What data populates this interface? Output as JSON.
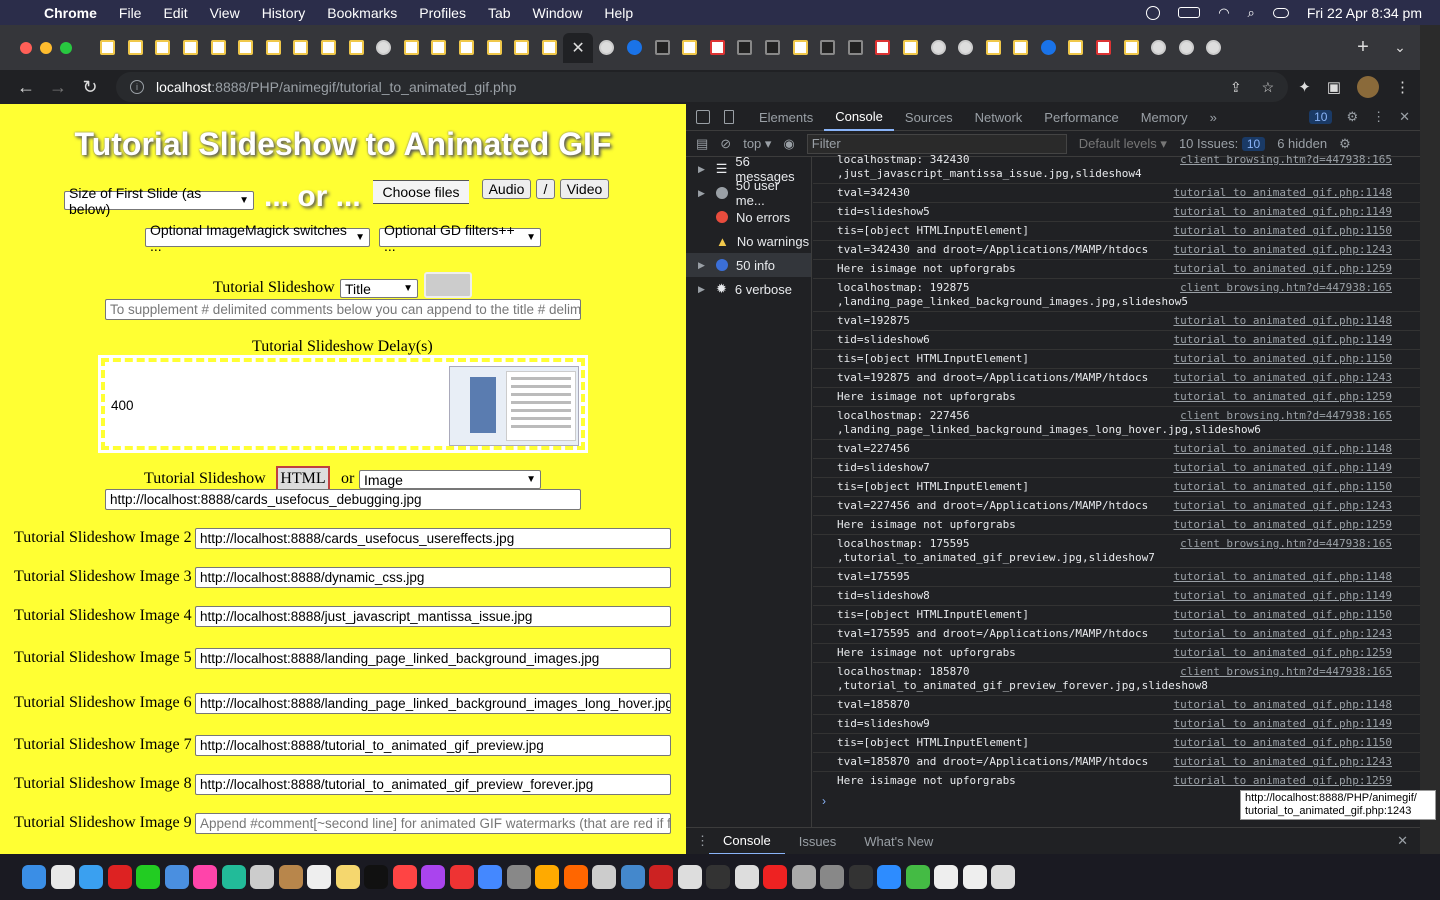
{
  "menubar": {
    "app": "Chrome",
    "items": [
      "File",
      "Edit",
      "View",
      "History",
      "Bookmarks",
      "Profiles",
      "Tab",
      "Window",
      "Help"
    ],
    "clock": "Fri 22 Apr  8:34 pm"
  },
  "browser": {
    "url_host": "localhost",
    "url_path": ":8888/PHP/animegif/tutorial_to_animated_gif.php"
  },
  "page": {
    "title": "Tutorial Slideshow to Animated GIF",
    "size_select": "Size of First Slide (as below)",
    "or_text": "... or ...",
    "choose_files": "Choose files",
    "audio": "Audio",
    "slash": "/",
    "video": "Video",
    "imagemagick": "Optional ImageMagick switches ...",
    "gd_filters": "Optional GD filters++ ...",
    "slideshow_label": "Tutorial Slideshow",
    "title_select": "Title",
    "comment_placeholder": "To supplement # delimited comments below you can append to the title # delimi",
    "delays_label": "Tutorial Slideshow Delay(s)",
    "delay_value": "400",
    "html_label": "Tutorial Slideshow",
    "html_btn": "HTML",
    "or": "or",
    "image_select": "Image",
    "image1": "http://localhost:8888/cards_usefocus_debugging.jpg",
    "images": [
      {
        "label": "Tutorial Slideshow Image 2",
        "value": "http://localhost:8888/cards_usefocus_usereffects.jpg"
      },
      {
        "label": "Tutorial Slideshow Image 3",
        "value": "http://localhost:8888/dynamic_css.jpg"
      },
      {
        "label": "Tutorial Slideshow Image 4",
        "value": "http://localhost:8888/just_javascript_mantissa_issue.jpg"
      },
      {
        "label": "Tutorial Slideshow Image 5",
        "value": "http://localhost:8888/landing_page_linked_background_images.jpg"
      },
      {
        "label": "Tutorial Slideshow Image 6",
        "value": "http://localhost:8888/landing_page_linked_background_images_long_hover.jpg"
      },
      {
        "label": "Tutorial Slideshow Image 7",
        "value": "http://localhost:8888/tutorial_to_animated_gif_preview.jpg"
      },
      {
        "label": "Tutorial Slideshow Image 8",
        "value": "http://localhost:8888/tutorial_to_animated_gif_preview_forever.jpg"
      },
      {
        "label": "Tutorial Slideshow Image 9",
        "value": "Append #comment[~second line] for animated GIF watermarks (that are red if fi"
      }
    ]
  },
  "devtools": {
    "tabs": [
      "Elements",
      "Console",
      "Sources",
      "Network",
      "Performance",
      "Memory"
    ],
    "more": "»",
    "badge": "10",
    "context": "top",
    "filter": "Filter",
    "levels": "Default levels",
    "issues": "10 Issues:",
    "issues_count": "10",
    "hidden": "6 hidden",
    "sidebar": [
      "56 messages",
      "50 user me...",
      "No errors",
      "No warnings",
      "50 info",
      "6 verbose"
    ],
    "logs": [
      {
        "msg": "localhostmap: 342430",
        "msg2": ",just_javascript_mantissa_issue.jpg,slideshow4",
        "src": "client browsing.htm?d=447938:165"
      },
      {
        "msg": "tval=342430",
        "src": "tutorial to animated gif.php:1148"
      },
      {
        "msg": "tid=slideshow5",
        "src": "tutorial to animated gif.php:1149"
      },
      {
        "msg": "tis=[object HTMLInputElement]",
        "src": "tutorial to animated gif.php:1150"
      },
      {
        "msg": "tval=342430  and droot=/Applications/MAMP/htdocs",
        "src": "tutorial to animated gif.php:1243"
      },
      {
        "msg": "Here isimage not upforgrabs",
        "src": "tutorial to animated gif.php:1259"
      },
      {
        "msg": "localhostmap: 192875",
        "msg2": ",landing_page_linked_background_images.jpg,slideshow5",
        "src": "client browsing.htm?d=447938:165"
      },
      {
        "msg": "tval=192875",
        "src": "tutorial to animated gif.php:1148"
      },
      {
        "msg": "tid=slideshow6",
        "src": "tutorial to animated gif.php:1149"
      },
      {
        "msg": "tis=[object HTMLInputElement]",
        "src": "tutorial to animated gif.php:1150"
      },
      {
        "msg": "tval=192875  and droot=/Applications/MAMP/htdocs",
        "src": "tutorial to animated gif.php:1243"
      },
      {
        "msg": "Here isimage not upforgrabs",
        "src": "tutorial to animated gif.php:1259"
      },
      {
        "msg": "localhostmap: 227456",
        "msg2": ",landing_page_linked_background_images_long_hover.jpg,slideshow6",
        "src": "client browsing.htm?d=447938:165"
      },
      {
        "msg": "tval=227456",
        "src": "tutorial to animated gif.php:1148"
      },
      {
        "msg": "tid=slideshow7",
        "src": "tutorial to animated gif.php:1149"
      },
      {
        "msg": "tis=[object HTMLInputElement]",
        "src": "tutorial to animated gif.php:1150"
      },
      {
        "msg": "tval=227456  and droot=/Applications/MAMP/htdocs",
        "src": "tutorial to animated gif.php:1243"
      },
      {
        "msg": "Here isimage not upforgrabs",
        "src": "tutorial to animated gif.php:1259"
      },
      {
        "msg": "localhostmap: 175595",
        "msg2": ",tutorial_to_animated_gif_preview.jpg,slideshow7",
        "src": "client browsing.htm?d=447938:165"
      },
      {
        "msg": "tval=175595",
        "src": "tutorial to animated gif.php:1148"
      },
      {
        "msg": "tid=slideshow8",
        "src": "tutorial to animated gif.php:1149"
      },
      {
        "msg": "tis=[object HTMLInputElement]",
        "src": "tutorial to animated gif.php:1150"
      },
      {
        "msg": "tval=175595  and droot=/Applications/MAMP/htdocs",
        "src": "tutorial to animated gif.php:1243"
      },
      {
        "msg": "Here isimage not upforgrabs",
        "src": "tutorial to animated gif.php:1259"
      },
      {
        "msg": "localhostmap: 185870",
        "msg2": ",tutorial_to_animated_gif_preview_forever.jpg,slideshow8",
        "src": "client browsing.htm?d=447938:165"
      },
      {
        "msg": "tval=185870",
        "src": "tutorial to animated gif.php:1148"
      },
      {
        "msg": "tid=slideshow9",
        "src": "tutorial to animated gif.php:1149"
      },
      {
        "msg": "tis=[object HTMLInputElement]",
        "src": "tutorial to animated gif.php:1150"
      },
      {
        "msg": "tval=185870  and droot=/Applications/MAMP/htdocs",
        "src": "tutorial to animated gif.php:1243"
      },
      {
        "msg": "Here isimage not upforgrabs",
        "src": "tutorial to animated gif.php:1259"
      }
    ],
    "tooltip_line1": "http://localhost:8888/PHP/animegif/",
    "tooltip_line2": "tutorial_to_animated_gif.php:1243",
    "drawer_tabs": [
      "Console",
      "Issues",
      "What's New"
    ]
  }
}
